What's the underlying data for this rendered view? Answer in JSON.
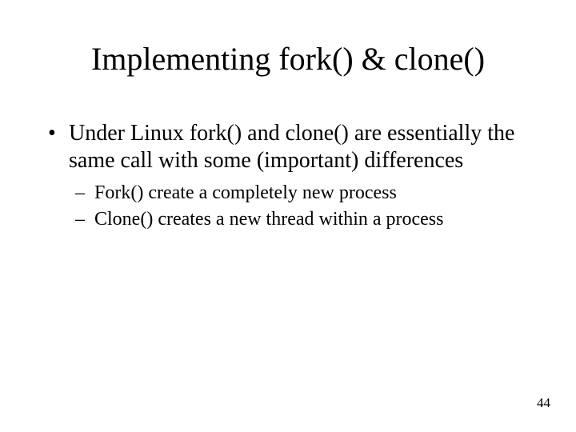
{
  "slide": {
    "title": "Implementing fork() & clone()",
    "bullets": [
      {
        "text": "Under Linux fork() and clone() are essentially the same call with some (important) differences",
        "sub": [
          "Fork() create a completely new process",
          "Clone() creates a new thread within a process"
        ]
      }
    ],
    "page_number": "44"
  }
}
